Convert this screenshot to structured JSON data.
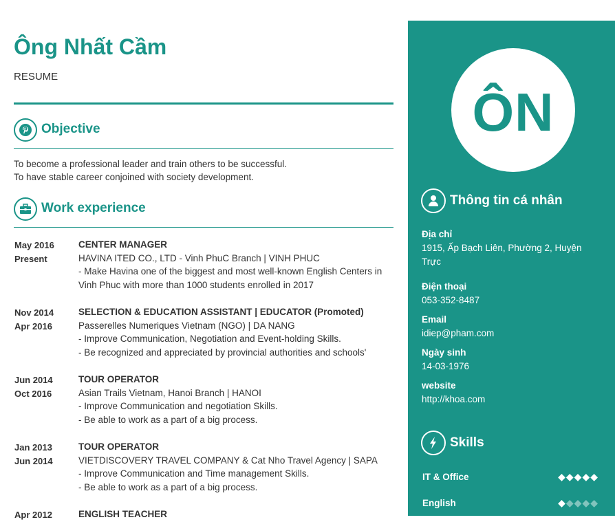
{
  "header": {
    "name": "Ông Nhất Cầm",
    "subtitle": "RESUME"
  },
  "objective": {
    "title": "Objective",
    "icon": "pinterest-icon",
    "lines": [
      "To become a professional leader and train others to be successful.",
      "To have stable career conjoined with society development."
    ]
  },
  "work": {
    "title": "Work experience",
    "icon": "briefcase-icon",
    "jobs": [
      {
        "start": "May 2016",
        "end": "Present",
        "role": "CENTER MANAGER",
        "company": "HAVINA ITED CO., LTD - Vinh PhuC Branch | VINH PHUC",
        "details": [
          "-  Make Havina one of the biggest and most well-known English Centers in Vinh Phuc with more than 1000 students enrolled in 2017"
        ]
      },
      {
        "start": "Nov 2014",
        "end": "Apr 2016",
        "role": "SELECTION & EDUCATION ASSISTANT | EDUCATOR (Promoted)",
        "company": "Passerelles Numeriques Vietnam (NGO) | DA NANG",
        "details": [
          "- Improve Communication, Negotiation and Event-holding Skills.",
          "- Be recognized and appreciated by provincial authorities and schools'"
        ]
      },
      {
        "start": "Jun 2014",
        "end": "Oct 2016",
        "role": "TOUR OPERATOR",
        "company": "Asian Trails Vietnam, Hanoi Branch | HANOI",
        "details": [
          "- Improve Communication and negotiation Skills.",
          "- Be able to work as a part of a big process."
        ]
      },
      {
        "start": "Jan 2013",
        "end": "Jun 2014",
        "role": "TOUR OPERATOR",
        "company": "VIETDISCOVERY TRAVEL COMPANY & Cat Nho Travel Agency | SAPA",
        "details": [
          "- Improve Communication and Time management Skills.",
          "- Be able to work as a part of a big process."
        ]
      },
      {
        "start": "Apr 2012",
        "end": "",
        "role": "ENGLISH TEACHER",
        "company": "",
        "details": []
      }
    ]
  },
  "sidebar": {
    "initials": "ÔN",
    "personal": {
      "title": "Thông tin cá nhân",
      "icon": "user-icon",
      "address_label": "Địa chỉ",
      "address": "1915, Ấp Bạch Liên, Phường 2, Huyện Trực",
      "phone_label": "Điện thoại",
      "phone": "053-352-8487",
      "email_label": "Email",
      "email": "idiep@pham.com",
      "dob_label": "Ngày sinh",
      "dob": "14-03-1976",
      "website_label": "website",
      "website": "http://khoa.com"
    },
    "skills": {
      "title": "Skills",
      "icon": "lightning-icon",
      "items": [
        {
          "name": "IT & Office",
          "rating": 5,
          "max": 5
        },
        {
          "name": "English",
          "rating": 1,
          "max": 5
        }
      ]
    }
  },
  "colors": {
    "accent": "#1a9488",
    "text": "#333333",
    "background": "#ffffff"
  }
}
